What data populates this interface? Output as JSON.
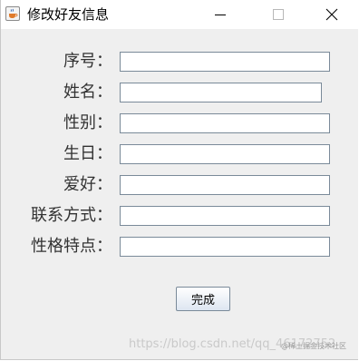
{
  "window": {
    "title": "修改好友信息",
    "icon": "java-cup-icon",
    "controls": [
      "minimize-icon",
      "maximize-icon",
      "close-icon"
    ]
  },
  "form": {
    "fields": [
      {
        "label": "序号：",
        "value": ""
      },
      {
        "label": "姓名：",
        "value": ""
      },
      {
        "label": "性别：",
        "value": ""
      },
      {
        "label": "生日：",
        "value": ""
      },
      {
        "label": "爱好：",
        "value": ""
      },
      {
        "label": "联系方式：",
        "value": ""
      },
      {
        "label": "性格特点：",
        "value": ""
      }
    ],
    "submit_label": "完成"
  },
  "watermark": {
    "url": "https://blog.csdn.net/qq_46172752",
    "tag": "@稀土掘金技术社区"
  }
}
